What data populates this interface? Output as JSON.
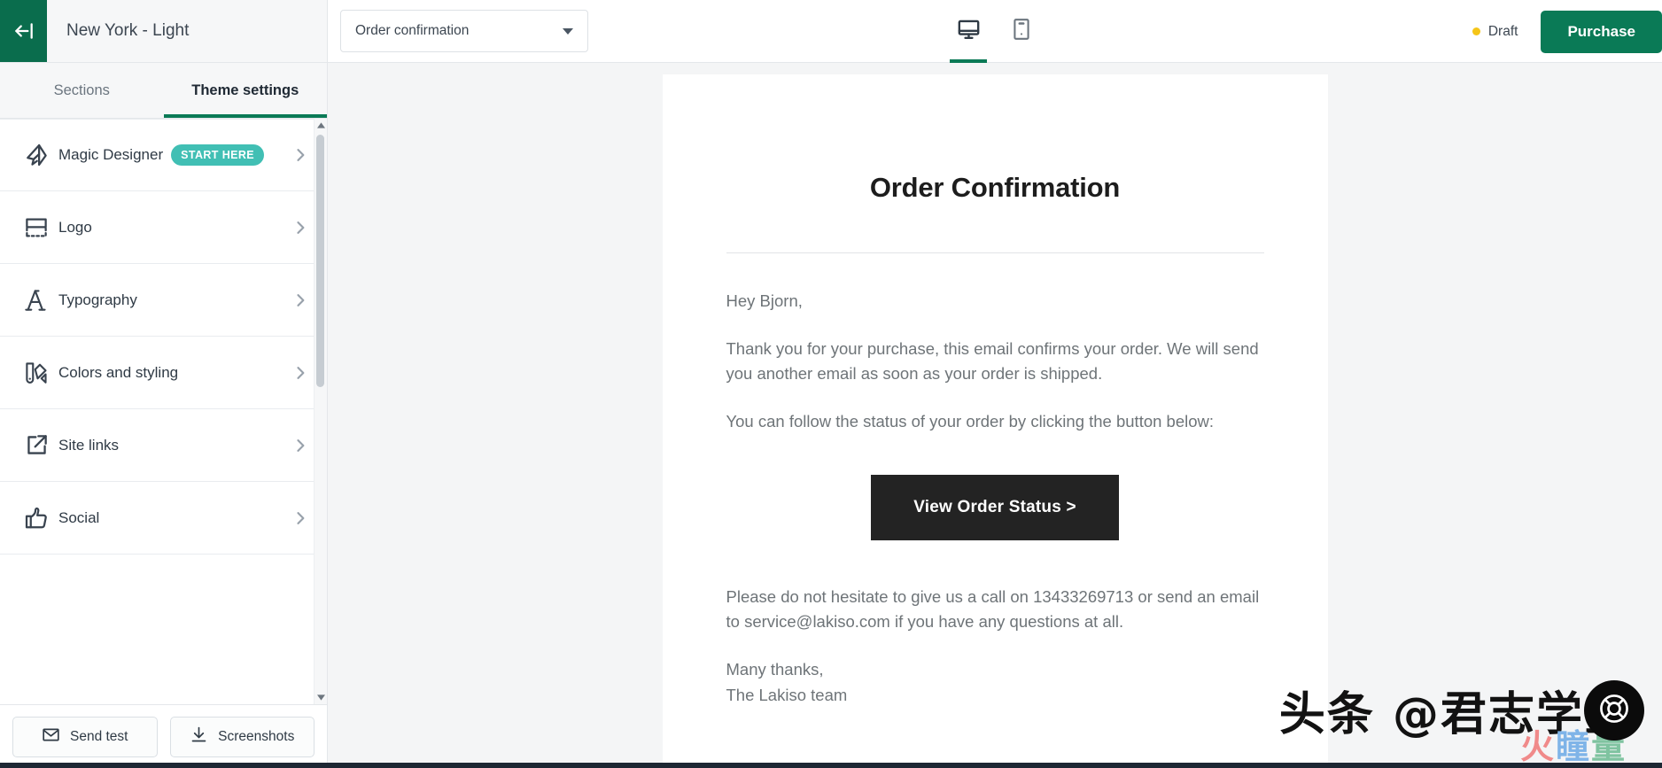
{
  "colors": {
    "brand_green_dark": "#0a6d4d",
    "brand_green": "#0a7a56",
    "badge_teal": "#41bfb4",
    "draft_yellow": "#f5c518",
    "cta_black": "#232323"
  },
  "topbar": {
    "back_icon": "back-arrow-icon",
    "theme_name": "New York - Light",
    "template_select": {
      "value": "Order confirmation",
      "caret_icon": "chevron-down-icon"
    },
    "devices": [
      {
        "name": "desktop",
        "icon": "desktop-monitor-icon",
        "active": true
      },
      {
        "name": "mobile",
        "icon": "mobile-phone-icon",
        "active": false
      }
    ],
    "status_label": "Draft",
    "purchase_label": "Purchase"
  },
  "sidebar": {
    "tabs": [
      {
        "label": "Sections",
        "active": false
      },
      {
        "label": "Theme settings",
        "active": true
      }
    ],
    "items": [
      {
        "label": "Magic Designer",
        "icon": "magic-designer-icon",
        "badge": "START HERE"
      },
      {
        "label": "Logo",
        "icon": "logo-placeholder-icon",
        "badge": ""
      },
      {
        "label": "Typography",
        "icon": "typography-a-icon",
        "badge": ""
      },
      {
        "label": "Colors and styling",
        "icon": "color-palette-icon",
        "badge": ""
      },
      {
        "label": "Site links",
        "icon": "external-link-icon",
        "badge": ""
      },
      {
        "label": "Social",
        "icon": "thumbs-up-icon",
        "badge": ""
      }
    ],
    "chevron_icon": "chevron-right-icon",
    "scroll_up_icon": "scroll-up-arrow",
    "scroll_down_icon": "scroll-down-arrow",
    "footer": {
      "send_test_label": "Send test",
      "send_test_icon": "envelope-icon",
      "screenshots_label": "Screenshots",
      "screenshots_icon": "download-icon"
    }
  },
  "email": {
    "title": "Order Confirmation",
    "greeting": "Hey Bjorn,",
    "paragraph_1": "Thank you for your purchase, this email confirms your order. We will send you another email as soon as your order is shipped.",
    "paragraph_2": "You can follow the status of your order by clicking the button below:",
    "cta_label": "View Order Status >",
    "paragraph_3": "Please do not hesitate to give us a call on 13433269713 or send an email to service@lakiso.com if you have any questions at all.",
    "signoff_line_1": "Many thanks,",
    "signoff_line_2": "The Lakiso team"
  },
  "overlay": {
    "watermark": "头条 @君志学堂",
    "watermark_sub_1": "火",
    "watermark_sub_2": "瞳",
    "watermark_sub_3": "量",
    "help_icon": "lifebuoy-help-icon"
  }
}
